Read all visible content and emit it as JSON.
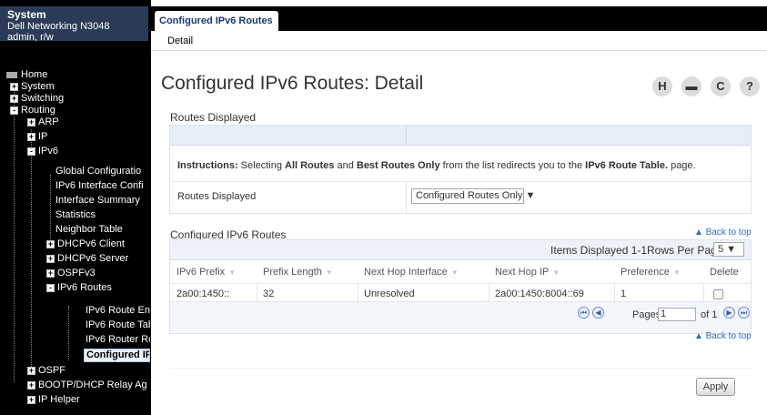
{
  "sidebar": {
    "system_title": "System",
    "device_name": "Dell Networking N3048",
    "user_role": "admin, r/w",
    "tree": [
      {
        "label": "Home",
        "icon": "home-icon"
      },
      {
        "label": "System",
        "toggle": "+"
      },
      {
        "label": "Switching",
        "toggle": "+"
      },
      {
        "label": "Routing",
        "toggle": "-"
      },
      {
        "label": "ARP",
        "toggle": "+"
      },
      {
        "label": "IP",
        "toggle": "+"
      },
      {
        "label": "IPv6",
        "toggle": "-"
      },
      {
        "label": "Global Configuratio"
      },
      {
        "label": "IPv6 Interface Confi"
      },
      {
        "label": "Interface Summary"
      },
      {
        "label": "Statistics"
      },
      {
        "label": "Neighbor Table"
      },
      {
        "label": "DHCPv6 Client",
        "toggle": "+"
      },
      {
        "label": "DHCPv6 Server",
        "toggle": "+"
      },
      {
        "label": "OSPFv3",
        "toggle": "+"
      },
      {
        "label": "IPv6 Routes",
        "toggle": "-"
      },
      {
        "label": "IPv6 Route Ent"
      },
      {
        "label": "IPv6 Route Tab"
      },
      {
        "label": "IPv6 Router Ro"
      },
      {
        "label": "Configured IF"
      },
      {
        "label": "OSPF",
        "toggle": "+"
      },
      {
        "label": "BOOTP/DHCP Relay Ag",
        "toggle": "+"
      },
      {
        "label": "IP Helper",
        "toggle": "+"
      }
    ]
  },
  "header": {
    "tab_label": "Configured IPv6 Routes",
    "subtab_label": "Detail"
  },
  "page": {
    "title": "Configured IPv6 Routes: Detail",
    "toolbar": {
      "save_glyph": "H",
      "print_glyph": "▬",
      "refresh_glyph": "C",
      "help_glyph": "?"
    }
  },
  "routes_displayed": {
    "section_title": "Routes Displayed",
    "instructions_prefix": "Instructions:",
    "instructions_part1": " Selecting ",
    "instructions_all": "All Routes",
    "instructions_and": " and ",
    "instructions_best": "Best Routes Only",
    "instructions_part2": " from the list redirects you to the ",
    "instructions_table": "IPv6 Route Table.",
    "instructions_end": " page.",
    "field_label": "Routes Displayed",
    "field_value": "Configured Routes Only ▼"
  },
  "routes_table": {
    "section_title": "Configured IPv6 Routes",
    "back_to_top": "▲ Back to top",
    "items_displayed": "Items Displayed 1-1",
    "rows_per_page_label": "Rows Per Page",
    "rows_per_page_value": "5  ▼",
    "columns": [
      "IPv6 Prefix",
      "Prefix Length",
      "Next Hop Interface",
      "Next Hop IP",
      "Preference",
      "Delete"
    ],
    "rows": [
      {
        "prefix": "2a00:1450::",
        "prefix_length": "32",
        "next_hop_interface": "Unresolved",
        "next_hop_ip": "2a00:1450:8004::69",
        "preference": "1"
      }
    ],
    "pages_label": "Pages",
    "page_value": "1",
    "of_label": "of 1",
    "back_to_top_bottom": "▲ Back to top"
  },
  "footer": {
    "apply_label": "Apply"
  },
  "colors": {
    "sidebar_bg": "#000000",
    "sidebar_header_bg": "#2b3b57",
    "panel_header_bg": "#e8eef7",
    "link": "#2a6ebb"
  }
}
